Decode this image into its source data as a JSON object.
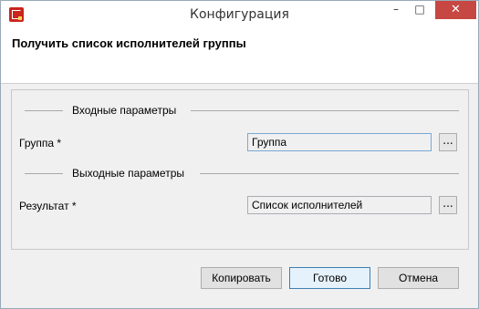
{
  "window": {
    "title": "Конфигурация",
    "controls": {
      "minimize": "–",
      "maximize": "□",
      "close": "✕"
    }
  },
  "header": {
    "title": "Получить список исполнителей группы"
  },
  "sections": {
    "input": {
      "label": "Входные параметры"
    },
    "output": {
      "label": "Выходные параметры"
    }
  },
  "fields": {
    "group": {
      "label": "Группа *",
      "value": "Группа",
      "browse": "..."
    },
    "result": {
      "label": "Результат *",
      "value": "Список исполнителей",
      "browse": "..."
    }
  },
  "buttons": {
    "copy": "Копировать",
    "ok": "Готово",
    "cancel": "Отмена"
  },
  "colors": {
    "close_button": "#c74743",
    "app_icon": "#c9261e"
  },
  "icons": {
    "app": "app-logo-icon"
  }
}
